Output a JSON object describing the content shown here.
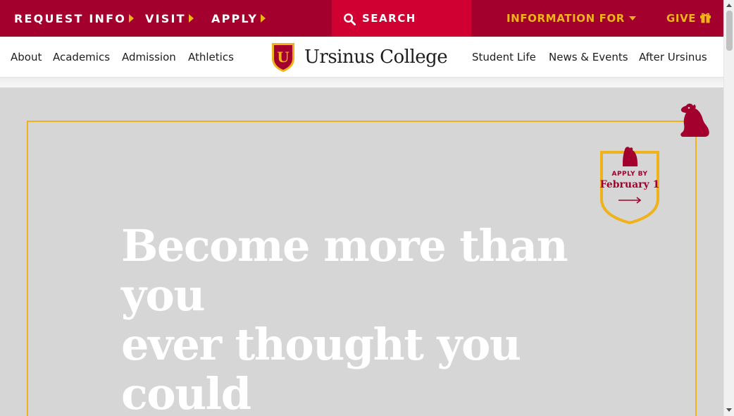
{
  "topbar": {
    "request_info": "REQUEST INFO",
    "visit": "VISIT",
    "apply": "APPLY",
    "search": "SEARCH",
    "information_for": "INFORMATION FOR",
    "give": "GIVE"
  },
  "nav": {
    "left": [
      "About",
      "Academics",
      "Admission",
      "Athletics"
    ],
    "right": [
      "Student Life",
      "News & Events",
      "After Ursinus"
    ]
  },
  "logo": {
    "shield_letter": "U",
    "name": "Ursinus College"
  },
  "hero": {
    "headline_line1": "Become more than you",
    "headline_line2": "ever thought you could",
    "badge_small": "APPLY BY",
    "badge_date": "February 1"
  },
  "colors": {
    "brand_red": "#a3002d",
    "search_red": "#d10032",
    "gold": "#f0b21a",
    "hero_bg": "#d6d6d6"
  },
  "icons": {
    "search": "search-icon",
    "gift": "gift-icon",
    "bear": "bear-icon",
    "shield": "shield-logo-icon"
  }
}
